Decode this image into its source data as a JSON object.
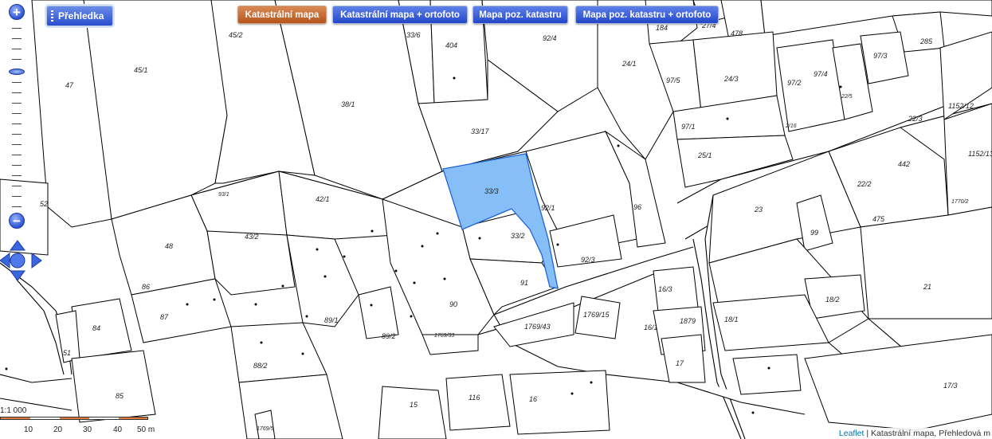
{
  "toolbar": {
    "overview_label": "Přehledka",
    "layers": [
      {
        "label": "Katastrální mapa",
        "active": true
      },
      {
        "label": "Katastrální mapa + ortofoto",
        "active": false
      },
      {
        "label": "Mapa poz. katastru",
        "active": false
      },
      {
        "label": "Mapa poz. katastru + ortofoto",
        "active": false
      }
    ]
  },
  "zoom": {
    "in_label": "+",
    "out_label": "−"
  },
  "scale": {
    "ratio": "1:1 000",
    "ticks": [
      "10",
      "20",
      "30",
      "40",
      "50 m"
    ]
  },
  "attribution": {
    "link": "Leaflet",
    "separator": " | ",
    "text": "Katastrální mapa, Přehledová m"
  },
  "map": {
    "selected_parcel": "33/3",
    "parcel_labels": [
      "45/2",
      "47",
      "45/1",
      "38/1",
      "33/6",
      "404",
      "92/4",
      "24/1",
      "184",
      "27/4",
      "478",
      "285",
      "97/3",
      "97/5",
      "24/3",
      "97/2",
      "97/4",
      "22/5",
      "1152/12",
      "33/17",
      "97/1",
      "25/1",
      "2/16",
      "22/3",
      "1152/13",
      "33/3",
      "92/1",
      "96",
      "442",
      "22/2",
      "52",
      "93/1",
      "42/1",
      "23",
      "475",
      "99",
      "1770/2",
      "48",
      "43/2",
      "33/2",
      "92/3",
      "21",
      "86",
      "87",
      "89/1",
      "90",
      "91",
      "16/3",
      "18/2",
      "84",
      "89/2",
      "1769/43",
      "1769/15",
      "16/1",
      "1879",
      "18/1",
      "51",
      "88/2",
      "1769/33",
      "17",
      "85",
      "116",
      "16",
      "15",
      "17/3",
      "1769/5"
    ]
  }
}
